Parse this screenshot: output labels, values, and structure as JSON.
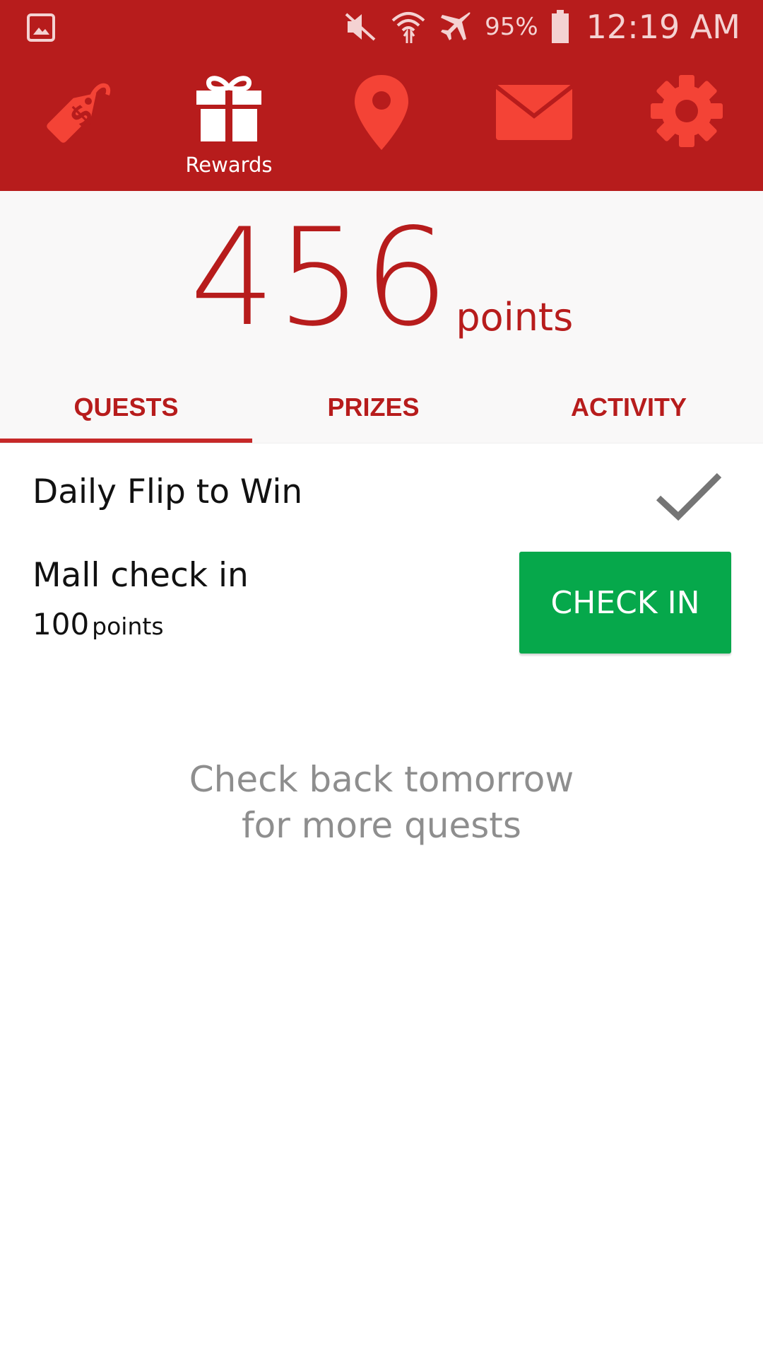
{
  "status_bar": {
    "battery_percent": "95%",
    "time": "12:19 AM",
    "icons": [
      "gallery-icon",
      "mute-icon",
      "wifi-icon",
      "airplane-mode-icon",
      "battery-icon"
    ]
  },
  "nav": {
    "items": [
      {
        "icon": "price-tag-icon",
        "label": "",
        "active": false
      },
      {
        "icon": "gift-icon",
        "label": "Rewards",
        "active": true
      },
      {
        "icon": "map-pin-icon",
        "label": "",
        "active": false
      },
      {
        "icon": "envelope-icon",
        "label": "",
        "active": false
      },
      {
        "icon": "gear-icon",
        "label": "",
        "active": false
      }
    ],
    "active_color": "#ffffff",
    "inactive_color": "#f44336"
  },
  "points": {
    "value": "456",
    "unit": "points"
  },
  "tabs": [
    {
      "label": "QUESTS",
      "active": true
    },
    {
      "label": "PRIZES",
      "active": false
    },
    {
      "label": "ACTIVITY",
      "active": false
    }
  ],
  "quests": [
    {
      "title": "Daily Flip to Win",
      "status": "completed"
    },
    {
      "title": "Mall check in",
      "points_value": "100",
      "points_unit": "points",
      "action_label": "CHECK IN"
    }
  ],
  "empty_message": {
    "line1": "Check back tomorrow",
    "line2": "for more quests"
  },
  "colors": {
    "brand_red": "#b71c1c",
    "check_in_green": "#06a84b"
  }
}
